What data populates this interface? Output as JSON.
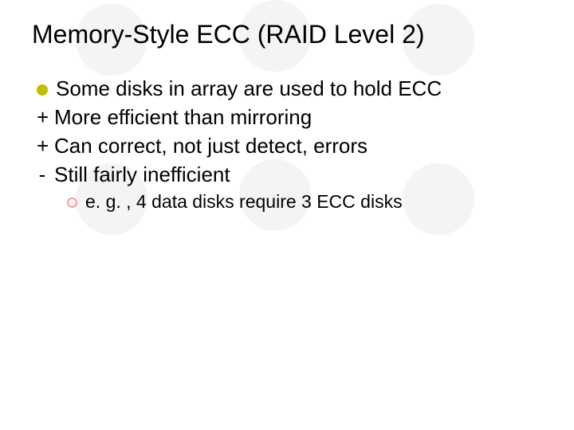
{
  "title": "Memory-Style ECC (RAID Level 2)",
  "bullets": {
    "b0": "Some disks in array are used to hold ECC",
    "b1": "More efficient than mirroring",
    "b2": "Can correct, not just detect, errors",
    "b3": "Still fairly inefficient",
    "s0": "e. g. , 4 data disks require 3 ECC disks"
  },
  "marks": {
    "plus": "+",
    "minus": "-"
  }
}
